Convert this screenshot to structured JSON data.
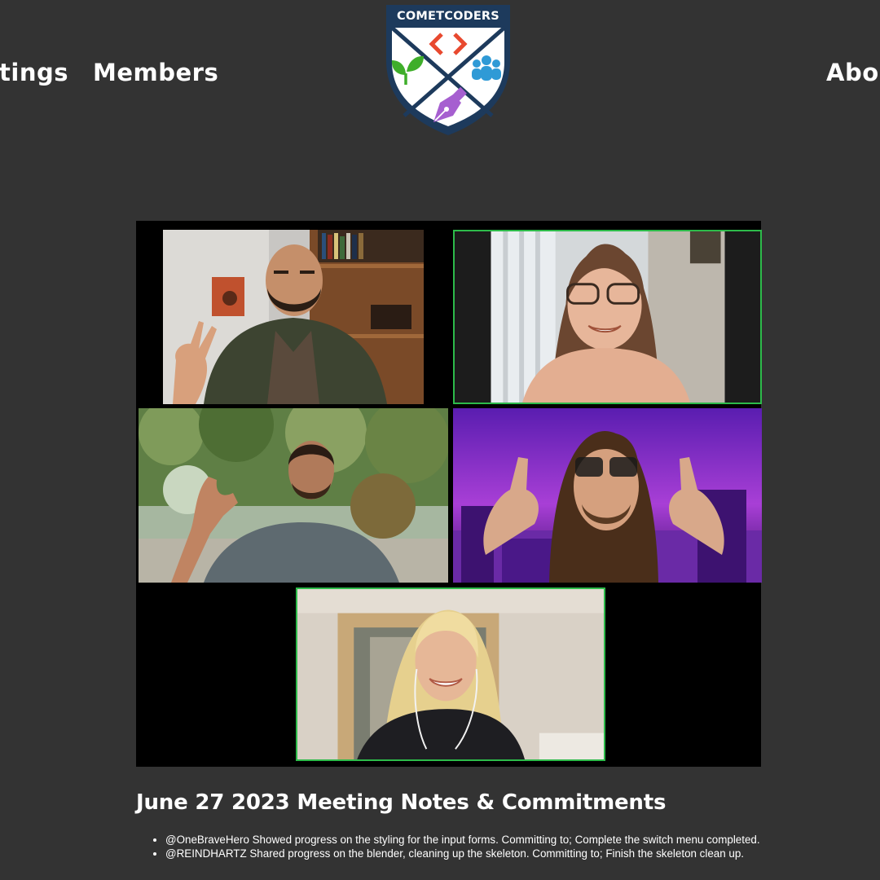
{
  "nav": {
    "meetings_label": "Meetings",
    "members_label": "Members",
    "about_label": "About"
  },
  "logo": {
    "title": "COMETCODERS",
    "icons": [
      "code-brackets-icon",
      "sprout-icon",
      "people-group-icon",
      "pen-nib-icon"
    ],
    "colors": {
      "navy": "#1d3a5c",
      "code": "#e8492f",
      "sprout": "#3fae2a",
      "people": "#2f9ad6",
      "pen": "#a65fd0"
    }
  },
  "video_call": {
    "active_border_color": "#2dbb4a",
    "participants": [
      {
        "tile": 1,
        "speaking_highlight": false
      },
      {
        "tile": 2,
        "speaking_highlight": true
      },
      {
        "tile": 3,
        "speaking_highlight": false
      },
      {
        "tile": 4,
        "speaking_highlight": false
      },
      {
        "tile": 5,
        "speaking_highlight": true
      }
    ]
  },
  "notes": {
    "title": "June 27 2023 Meeting Notes & Commitments",
    "items": [
      "@OneBraveHero Showed progress on the styling for the input forms. Committing to; Complete the switch menu completed.",
      "@REINDHARTZ Shared progress on the blender, cleaning up the skeleton. Committing to; Finish the skeleton clean up."
    ]
  }
}
